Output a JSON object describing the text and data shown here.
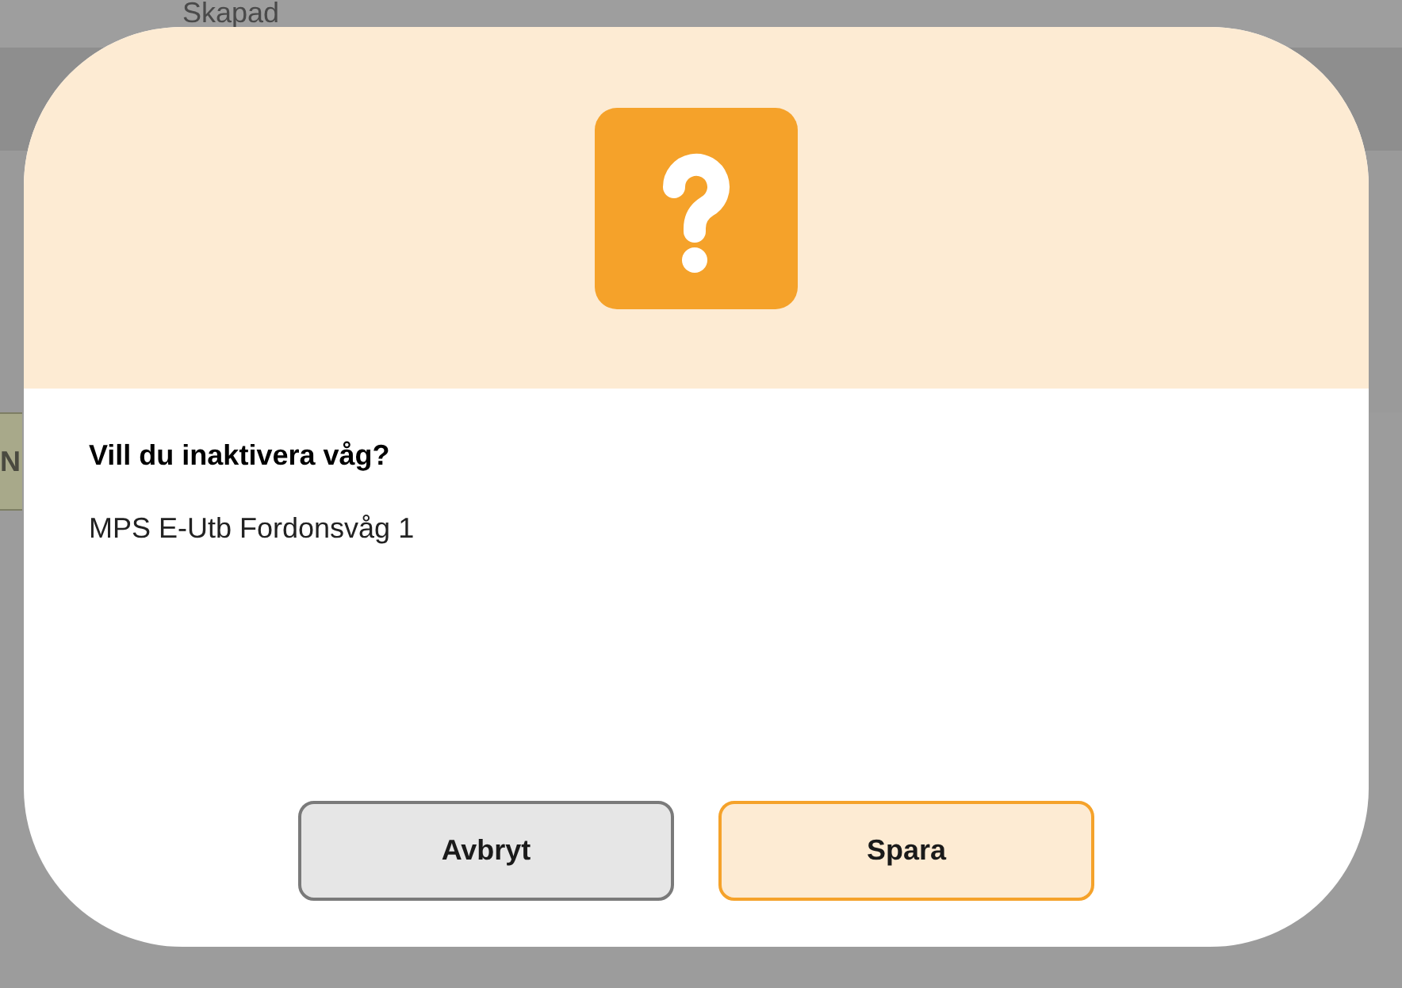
{
  "background": {
    "column_header": "Skapad",
    "button_fragment": "N"
  },
  "dialog": {
    "title": "Vill du inaktivera våg?",
    "message": "MPS E-Utb Fordonsvåg 1",
    "buttons": [
      {
        "label": "Avbryt",
        "kind": "secondary"
      },
      {
        "label": "Spara",
        "kind": "primary"
      }
    ]
  }
}
